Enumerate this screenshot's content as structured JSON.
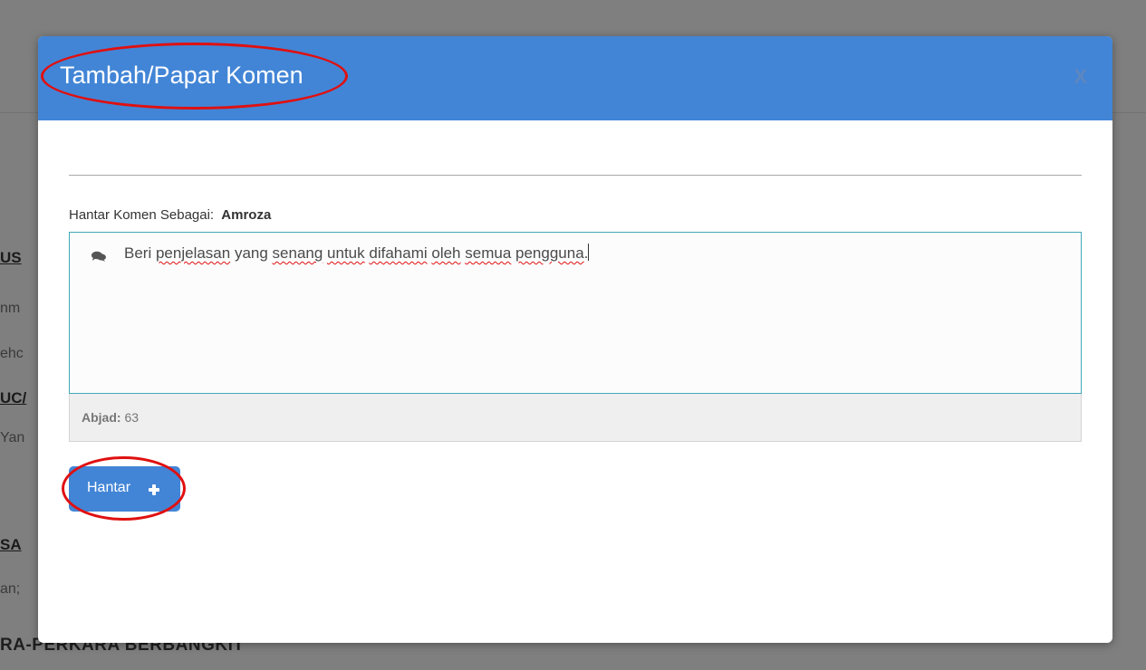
{
  "background": {
    "fragments": [
      {
        "text": "US",
        "style": "heading"
      },
      {
        "text": "nm",
        "style": "plain"
      },
      {
        "text": "ehc",
        "style": "plain"
      },
      {
        "text": "UC/",
        "style": "heading"
      },
      {
        "text": "Yan",
        "style": "plain"
      },
      {
        "text": "SA",
        "style": "heading"
      },
      {
        "text": "an;",
        "style": "plain"
      }
    ],
    "bottom_heading": "RA-PERKARA BERBANGKIT"
  },
  "modal": {
    "title": "Tambah/Papar Komen",
    "close_label": "X",
    "send_as_label": "Hantar Komen Sebagai:",
    "send_as_user": "Amroza",
    "comment": {
      "icon": "comments-icon",
      "segments": [
        {
          "text": "Beri ",
          "spell": false
        },
        {
          "text": "penjelasan",
          "spell": true
        },
        {
          "text": " yang ",
          "spell": false
        },
        {
          "text": "senang",
          "spell": true
        },
        {
          "text": " ",
          "spell": false
        },
        {
          "text": "untuk",
          "spell": true
        },
        {
          "text": " ",
          "spell": false
        },
        {
          "text": "difahami",
          "spell": true
        },
        {
          "text": " ",
          "spell": false
        },
        {
          "text": "oleh",
          "spell": true
        },
        {
          "text": " ",
          "spell": false
        },
        {
          "text": "semua",
          "spell": true
        },
        {
          "text": " ",
          "spell": false
        },
        {
          "text": "pengguna",
          "spell": true
        },
        {
          "text": ".",
          "spell": false
        }
      ]
    },
    "char_count_label": "Abjad:",
    "char_count_value": "63",
    "send_button_label": "Hantar",
    "send_button_icon": "plus-icon"
  },
  "colors": {
    "header": "#4285d6",
    "annotation": "#e01010",
    "textarea_border": "#41a8b8"
  }
}
